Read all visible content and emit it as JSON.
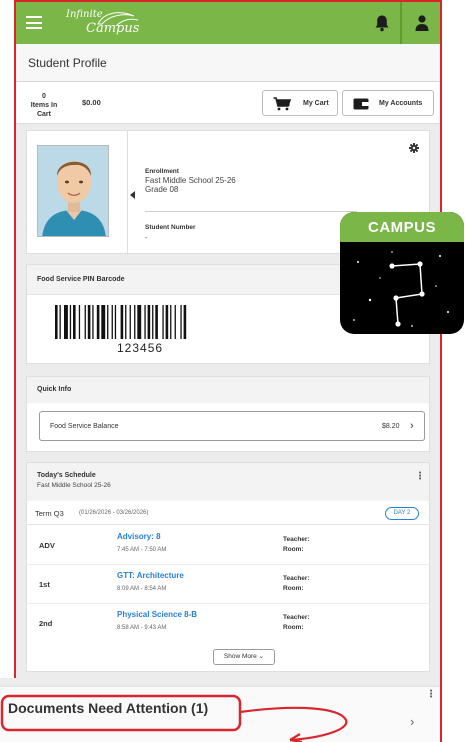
{
  "header": {
    "logo_top": "Infinite",
    "logo_bottom": "Campus",
    "brand_green": "#7ab648",
    "menu_icon": "hamburger-icon",
    "bell_icon": "bell-icon",
    "user_icon": "user-icon"
  },
  "page": {
    "title": "Student Profile"
  },
  "cart": {
    "count": "0",
    "count_label": "Items In Cart",
    "total": "$0.00",
    "my_cart_label": "My Cart",
    "my_accounts_label": "My Accounts"
  },
  "student": {
    "enrollment_label": "Enrollment",
    "school": "Fast Middle School 25-26",
    "grade": "Grade 08",
    "number_label": "Student Number",
    "number_value": "-"
  },
  "food_service": {
    "title": "Food Service PIN Barcode",
    "pin": "123456"
  },
  "app_icon": {
    "label": "CAMPUS"
  },
  "quick_info": {
    "title": "Quick Info",
    "item_label": "Food Service Balance",
    "item_value": "$8.20"
  },
  "schedule": {
    "title": "Today's Schedule",
    "school": "Fast Middle School 25-26",
    "term_label": "Term Q3",
    "term_dates": "(01/26/2026 - 03/26/2026)",
    "day_badge": "DAY 2",
    "periods": [
      {
        "period": "ADV",
        "course": "Advisory: 8",
        "time": "7:45 AM - 7:50 AM",
        "teacher_label": "Teacher:",
        "room_label": "Room:"
      },
      {
        "period": "1st",
        "course": "GTT: Architecture",
        "time": "8:09 AM - 8:54 AM",
        "teacher_label": "Teacher:",
        "room_label": "Room:"
      },
      {
        "period": "2nd",
        "course": "Physical Science 8-B",
        "time": "8:58 AM - 9:43 AM",
        "teacher_label": "Teacher:",
        "room_label": "Room:"
      }
    ],
    "show_more": "Show More"
  },
  "documents": {
    "title": "Documents Need Attention (1)",
    "highlight_color": "#d9262c"
  }
}
